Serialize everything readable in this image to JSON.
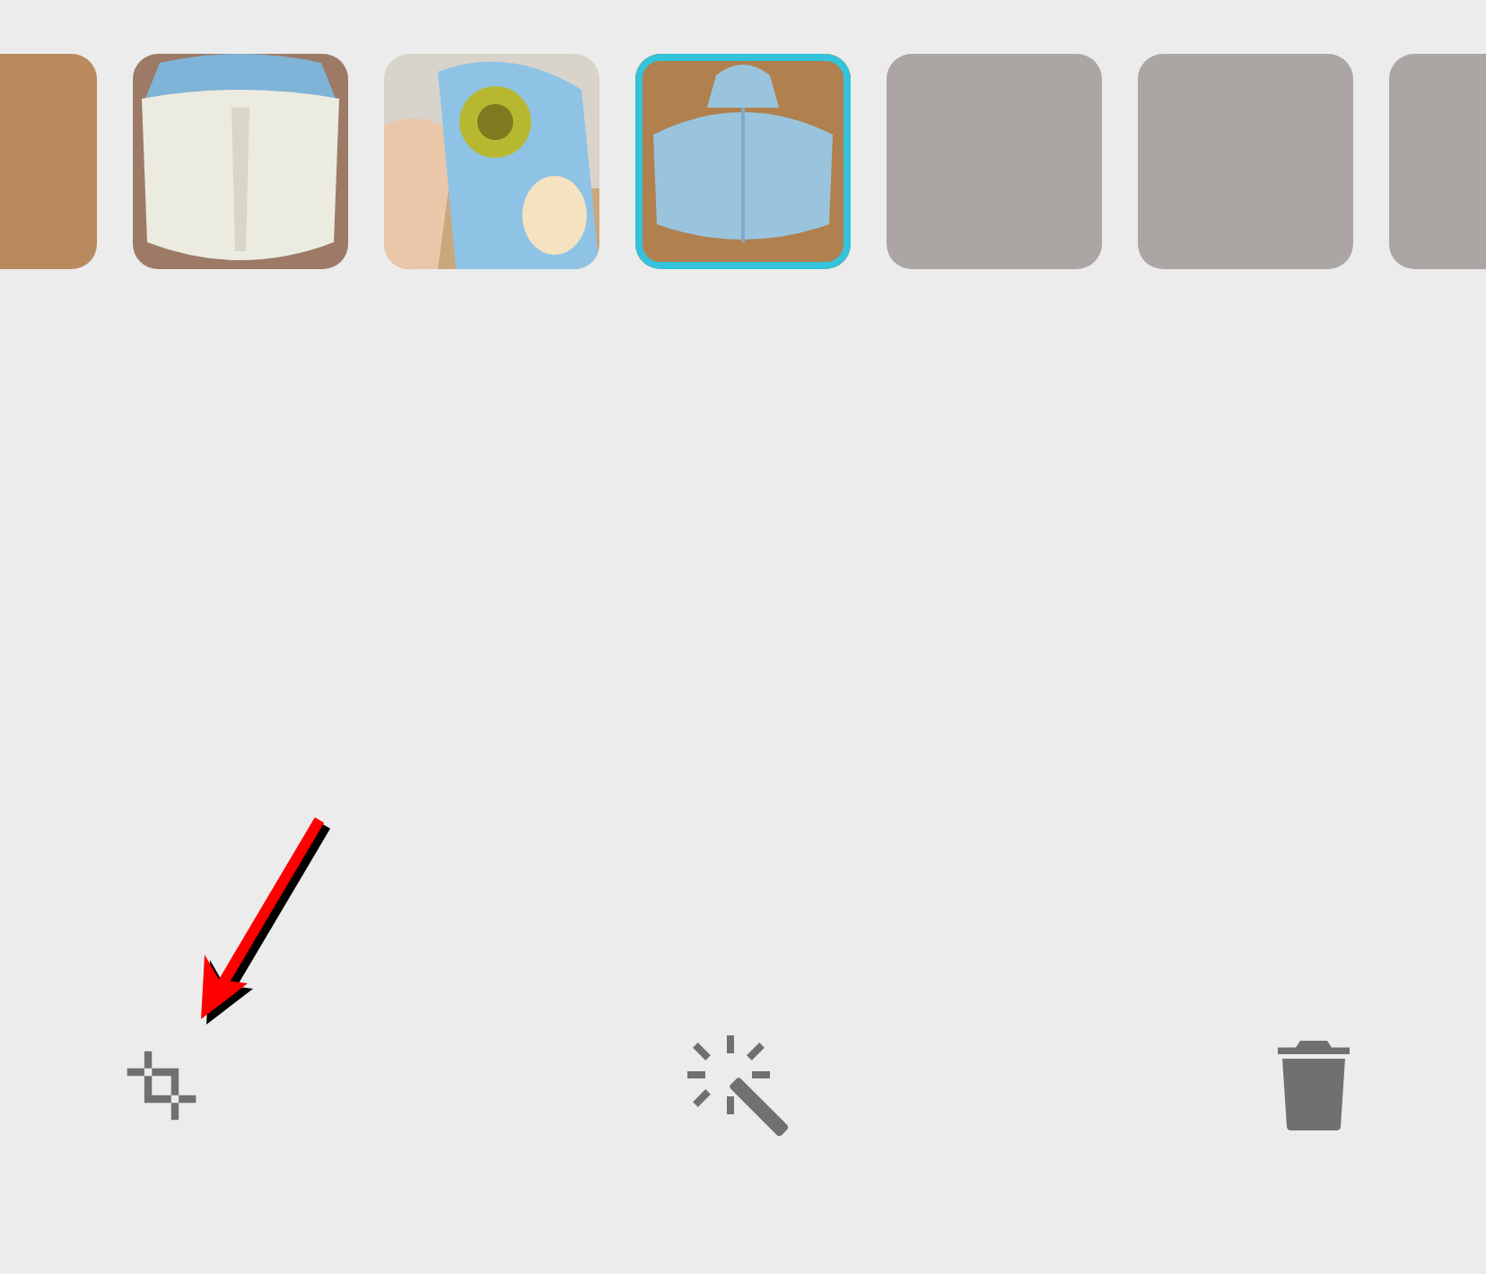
{
  "thumbnails": [
    {
      "kind": "picture",
      "selected": false
    },
    {
      "kind": "picture",
      "selected": false
    },
    {
      "kind": "picture",
      "selected": false
    },
    {
      "kind": "picture",
      "selected": true
    },
    {
      "kind": "empty",
      "selected": false
    },
    {
      "kind": "empty",
      "selected": false
    },
    {
      "kind": "empty",
      "selected": false
    }
  ],
  "toolbar": [
    {
      "kind": "crop"
    },
    {
      "kind": "magic"
    },
    {
      "kind": "delete"
    }
  ],
  "annotation": {
    "kind": "arrow"
  }
}
